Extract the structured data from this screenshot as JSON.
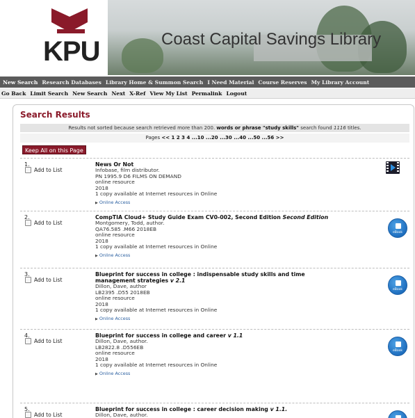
{
  "header": {
    "logo_text": "KPU",
    "title": "Coast Capital Savings Library"
  },
  "nav_primary": [
    "New Search",
    "Research Databases",
    "Library Home & Summon Search",
    "I Need Material",
    "Course Reserves",
    "My Library Account"
  ],
  "nav_secondary": [
    "Go Back",
    "Limit Search",
    "New Search",
    "Next",
    "X-Ref",
    "View My List",
    "Permalink",
    "Logout"
  ],
  "results": {
    "title": "Search Results",
    "status_pre": "Results not sorted because search retrieved more than 200.",
    "status_bold": "words or phrase \"study skills\"",
    "status_mid": "search found",
    "status_count": "1116",
    "status_post": "titles.",
    "pages_label": "Pages",
    "pages_links": "<< 1 2 3 4 ...10 ...20 ...30 ...40 ...50 ...56 >>",
    "keep_all_label": "Keep All on this Page",
    "add_to_list_label": "Add to List",
    "online_access_label": "Online Access",
    "ebook_label": "eBook"
  },
  "records": [
    {
      "num": "1.",
      "title": "News Or Not",
      "title_ital": "",
      "lines": [
        "Infobase, film distributor.",
        "PN 1995.9 D6 FILMS ON DEMAND",
        "online resource",
        "2018",
        "1 copy available at Internet resources in Online"
      ],
      "icon": "film-icon"
    },
    {
      "num": "2.",
      "title": "CompTIA Cloud+ Study Guide Exam CV0-002, Second Edition",
      "title_ital": "Second Edition",
      "lines": [
        "Montgomery, Todd, author.",
        "QA76.585 .M66 2018EB",
        "online resource",
        "2018",
        "1 copy available at Internet resources in Online"
      ],
      "icon": "ebook-icon"
    },
    {
      "num": "3.",
      "title": "Blueprint for success in college : indispensable study skills and time management strategies",
      "title_ital": "v 2.1",
      "lines": [
        "Dillon, Dave, author",
        "LB2395 .D55 2018EB",
        "online resource",
        "2018",
        "1 copy available at Internet resources in Online"
      ],
      "icon": "ebook-icon"
    },
    {
      "num": "4.",
      "title": "Blueprint for success in college and career",
      "title_ital": "v 1.1",
      "lines": [
        "Dillon, Dave, author.",
        "LB2822.8 .D556EB",
        "online resource",
        "2018",
        "1 copy available at Internet resources in Online"
      ],
      "icon": "ebook-icon"
    },
    {
      "num": "5.",
      "title": "Blueprint for success in college : career decision making",
      "title_ital": "v 1.1.",
      "lines": [
        "Dillon, Dave, author."
      ],
      "icon": "ebook-icon"
    }
  ]
}
